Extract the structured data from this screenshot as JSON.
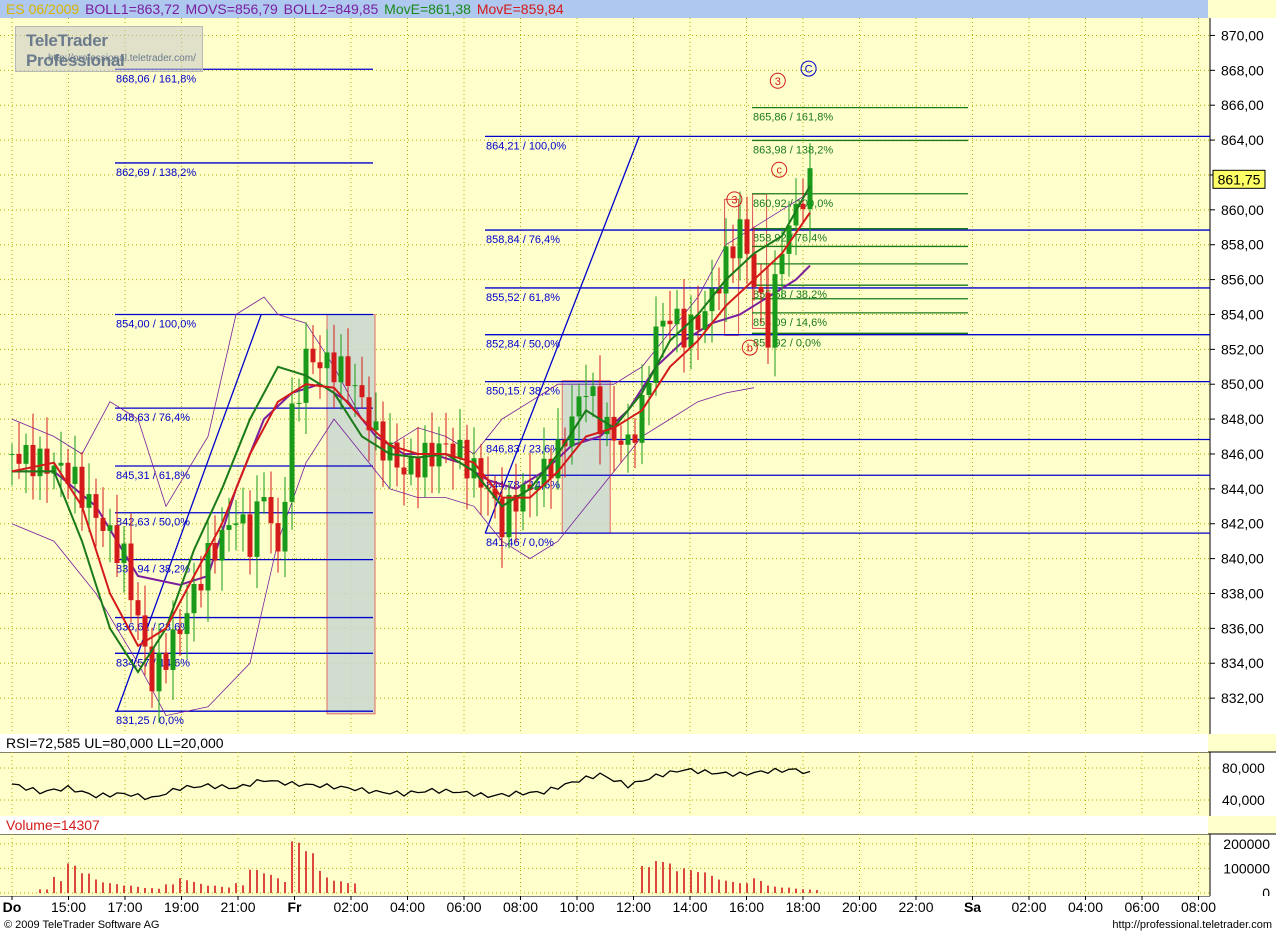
{
  "header": {
    "symbol": "ES 06/2009",
    "indicators": [
      {
        "label": "BOLL1=863,72",
        "color": "#7a1e9e"
      },
      {
        "label": "MOVS=856,79",
        "color": "#7a1e9e"
      },
      {
        "label": "BOLL2=849,85",
        "color": "#7a1e9e"
      },
      {
        "label": "MovE=861,38",
        "color": "#1a8a1a"
      },
      {
        "label": "MovE=859,84",
        "color": "#d41a1a"
      }
    ]
  },
  "logo": {
    "title": "TeleTrader Professional",
    "url": "http://professional.teletrader.com/"
  },
  "current_price": "861,75",
  "rsi_header": "RSI=72,585 UL=80,000 LL=20,000",
  "volume_header": "Volume=14307",
  "footer": {
    "left": "© 2009 TeleTrader Software AG",
    "right": "http://professional.teletrader.com"
  },
  "colors": {
    "background": "#ffffcc",
    "header_bg": "#aec8ef",
    "grid": "#b0b000",
    "fib_blue": "#0000cc",
    "fib_green": "#1a7a1a",
    "bull": "#1a9a1a",
    "bear": "#d41a1a",
    "purple": "#7a1e9e",
    "box_fill": "#c9d8d0",
    "box_edge": "#e05050"
  },
  "chart_data": [
    {
      "type": "candlestick",
      "title": "ES 06/2009",
      "ylim": [
        830,
        871
      ],
      "y_ticks": [
        "832,00",
        "834,00",
        "836,00",
        "838,00",
        "840,00",
        "842,00",
        "844,00",
        "846,00",
        "848,00",
        "850,00",
        "852,00",
        "854,00",
        "856,00",
        "858,00",
        "860,00",
        "862,00",
        "864,00",
        "866,00",
        "868,00",
        "870,00"
      ],
      "x_ticks": [
        "Do",
        "15:00",
        "17:00",
        "19:00",
        "21:00",
        "Fr",
        "02:00",
        "04:00",
        "06:00",
        "08:00",
        "10:00",
        "12:00",
        "14:00",
        "16:00",
        "18:00",
        "20:00",
        "22:00",
        "Sa",
        "02:00",
        "04:00",
        "06:00",
        "08:00"
      ],
      "x_tick_bold": [
        true,
        false,
        false,
        false,
        false,
        true,
        false,
        false,
        false,
        false,
        false,
        false,
        false,
        false,
        false,
        false,
        false,
        true,
        false,
        false,
        false,
        false
      ],
      "grid": true,
      "close_path": [
        [
          0,
          846.0
        ],
        [
          4,
          845.0
        ],
        [
          8,
          840.0
        ],
        [
          10,
          833.0
        ],
        [
          12,
          836.0
        ],
        [
          14,
          840.0
        ],
        [
          16,
          842.5
        ],
        [
          17,
          841.0
        ],
        [
          18,
          844.0
        ],
        [
          19,
          840.0
        ],
        [
          20,
          848.0
        ],
        [
          21,
          851.5
        ],
        [
          23,
          851.0
        ],
        [
          24,
          850.5
        ],
        [
          25,
          849.0
        ],
        [
          26,
          847.0
        ],
        [
          27,
          846.0
        ],
        [
          28,
          845.0
        ],
        [
          29,
          845.5
        ],
        [
          30,
          846.0
        ],
        [
          31,
          846.5
        ],
        [
          32,
          846.0
        ],
        [
          34,
          844.0
        ],
        [
          35,
          842.0
        ],
        [
          36,
          843.5
        ],
        [
          37,
          844.0
        ],
        [
          38,
          845.0
        ],
        [
          39,
          846.0
        ],
        [
          40,
          848.0
        ],
        [
          41,
          850.0
        ],
        [
          42,
          848.0
        ],
        [
          43,
          847.0
        ],
        [
          44,
          846.5
        ],
        [
          45,
          848.5
        ],
        [
          46,
          853.0
        ],
        [
          47,
          854.0
        ],
        [
          48,
          853.0
        ],
        [
          49,
          853.5
        ],
        [
          50,
          855.0
        ],
        [
          51,
          857.0
        ],
        [
          52,
          859.0
        ],
        [
          53,
          856.0
        ],
        [
          54,
          853.0
        ],
        [
          55,
          858.0
        ],
        [
          56,
          860.0
        ],
        [
          57,
          861.5
        ]
      ],
      "bollinger": {
        "upper": [
          [
            0,
            848
          ],
          [
            3,
            847
          ],
          [
            5,
            846
          ],
          [
            7,
            849
          ],
          [
            9,
            848
          ],
          [
            11,
            843
          ],
          [
            14,
            847
          ],
          [
            16,
            854
          ],
          [
            18,
            855
          ],
          [
            19,
            854
          ],
          [
            21,
            853.5
          ],
          [
            23,
            851
          ],
          [
            25,
            848
          ],
          [
            27,
            846.5
          ],
          [
            29,
            847.5
          ],
          [
            31,
            847
          ],
          [
            33,
            846
          ],
          [
            35,
            848
          ],
          [
            37,
            849
          ],
          [
            39,
            850
          ],
          [
            41,
            850
          ],
          [
            43,
            850
          ],
          [
            45,
            851
          ],
          [
            47,
            853
          ],
          [
            49,
            855
          ],
          [
            51,
            858
          ],
          [
            53,
            859
          ],
          [
            55,
            860
          ],
          [
            57,
            861
          ]
        ],
        "middle": [
          [
            0,
            845
          ],
          [
            3,
            845
          ],
          [
            6,
            843
          ],
          [
            9,
            839
          ],
          [
            12,
            838.5
          ],
          [
            14,
            839
          ],
          [
            16,
            844
          ],
          [
            18,
            848
          ],
          [
            20,
            849.5
          ],
          [
            22,
            850
          ],
          [
            24,
            849
          ],
          [
            26,
            847
          ],
          [
            28,
            846
          ],
          [
            30,
            846
          ],
          [
            32,
            845.5
          ],
          [
            34,
            844.5
          ],
          [
            36,
            844
          ],
          [
            38,
            845
          ],
          [
            40,
            846.5
          ],
          [
            42,
            847
          ],
          [
            44,
            848.5
          ],
          [
            46,
            851
          ],
          [
            48,
            852.5
          ],
          [
            50,
            853.5
          ],
          [
            52,
            854
          ],
          [
            54,
            855
          ],
          [
            56,
            856
          ],
          [
            57,
            856.8
          ]
        ],
        "lower": [
          [
            0,
            842
          ],
          [
            3,
            841
          ],
          [
            6,
            838
          ],
          [
            9,
            834
          ],
          [
            11,
            831
          ],
          [
            14,
            831.5
          ],
          [
            17,
            834
          ],
          [
            19,
            841
          ],
          [
            21,
            845.5
          ],
          [
            23,
            848
          ],
          [
            25,
            846
          ],
          [
            27,
            844
          ],
          [
            29,
            843.5
          ],
          [
            31,
            843.5
          ],
          [
            33,
            843
          ],
          [
            35,
            841
          ],
          [
            37,
            840
          ],
          [
            39,
            841
          ],
          [
            41,
            843
          ],
          [
            43,
            845
          ],
          [
            45,
            847
          ],
          [
            47,
            848
          ],
          [
            49,
            849
          ],
          [
            51,
            849.5
          ],
          [
            53,
            849.8
          ]
        ]
      },
      "mov_green": [
        [
          0,
          845
        ],
        [
          3,
          845
        ],
        [
          5,
          841
        ],
        [
          7,
          836
        ],
        [
          9,
          833.5
        ],
        [
          11,
          836
        ],
        [
          13,
          840.5
        ],
        [
          15,
          844
        ],
        [
          17,
          848
        ],
        [
          19,
          851
        ],
        [
          21,
          850.5
        ],
        [
          23,
          849.5
        ],
        [
          25,
          847
        ],
        [
          27,
          846
        ],
        [
          29,
          845.8
        ],
        [
          31,
          846
        ],
        [
          33,
          845
        ],
        [
          35,
          843
        ],
        [
          37,
          844
        ],
        [
          39,
          846
        ],
        [
          41,
          848.5
        ],
        [
          43,
          847.5
        ],
        [
          45,
          849.5
        ],
        [
          47,
          852.5
        ],
        [
          49,
          854
        ],
        [
          51,
          856
        ],
        [
          53,
          857.5
        ],
        [
          55,
          858.5
        ],
        [
          57,
          861.38
        ]
      ],
      "mov_red": [
        [
          0,
          845
        ],
        [
          3,
          845.5
        ],
        [
          5,
          843
        ],
        [
          7,
          838
        ],
        [
          9,
          835
        ],
        [
          11,
          836
        ],
        [
          13,
          839
        ],
        [
          15,
          842
        ],
        [
          17,
          846
        ],
        [
          19,
          849
        ],
        [
          21,
          850
        ],
        [
          23,
          849.8
        ],
        [
          25,
          848
        ],
        [
          27,
          846.5
        ],
        [
          29,
          846
        ],
        [
          31,
          846
        ],
        [
          33,
          845.5
        ],
        [
          35,
          843.5
        ],
        [
          37,
          843.5
        ],
        [
          39,
          845
        ],
        [
          41,
          847
        ],
        [
          43,
          847.5
        ],
        [
          45,
          848.5
        ],
        [
          47,
          851
        ],
        [
          49,
          852.5
        ],
        [
          51,
          854.5
        ],
        [
          53,
          856
        ],
        [
          55,
          857.5
        ],
        [
          57,
          859.84
        ]
      ],
      "fib_sets": [
        {
          "name": "fib-set-1",
          "levels": [
            {
              "price": 868.06,
              "label": "868,06 / 161,8%"
            },
            {
              "price": 862.69,
              "label": "862,69 / 138,2%"
            },
            {
              "price": 854.0,
              "label": "854,00 / 100,0%"
            },
            {
              "price": 848.63,
              "label": "848,63 / 76,4%"
            },
            {
              "price": 845.31,
              "label": "845,31 / 61,8%"
            },
            {
              "price": 842.63,
              "label": "842,63 / 50,0%"
            },
            {
              "price": 839.94,
              "label": "839,94 / 38,2%"
            },
            {
              "price": 836.62,
              "label": "836,62 / 23,6%"
            },
            {
              "price": 834.57,
              "label": "834,57 / 14,6%"
            },
            {
              "price": 831.25,
              "label": "831,25 / 0,0%"
            }
          ]
        },
        {
          "name": "fib-set-2",
          "levels": [
            {
              "price": 864.21,
              "label": "864,21 / 100,0%"
            },
            {
              "price": 858.84,
              "label": "858,84 / 76,4%"
            },
            {
              "price": 855.52,
              "label": "855,52 / 61,8%"
            },
            {
              "price": 852.84,
              "label": "852,84 / 50,0%"
            },
            {
              "price": 850.15,
              "label": "850,15 / 38,2%"
            },
            {
              "price": 846.83,
              "label": "846,83 / 23,6%"
            },
            {
              "price": 844.78,
              "label": "844,78 / 14,6%"
            },
            {
              "price": 841.46,
              "label": "841,46 / 0,0%"
            }
          ]
        },
        {
          "name": "fib-set-3",
          "levels": [
            {
              "price": 865.86,
              "label": "865,86 / 161,8%"
            },
            {
              "price": 863.98,
              "label": "863,98 / 138,2%"
            },
            {
              "price": 860.92,
              "label": "860,92 / 100,0%"
            },
            {
              "price": 858.92,
              "label": "858,92 / 76,4%"
            },
            {
              "price": 857.9,
              "label": ""
            },
            {
              "price": 856.9,
              "label": ""
            },
            {
              "price": 855.68,
              "label": "855,68 / 38,2%"
            },
            {
              "price": 854.9,
              "label": ""
            },
            {
              "price": 854.09,
              "label": "854,09 / 14,6%"
            },
            {
              "price": 852.92,
              "label": "852,92 / 0,0%"
            }
          ]
        }
      ],
      "wave_labels": [
        "3",
        "C",
        "3",
        "c",
        "b"
      ],
      "current_price": 861.75
    },
    {
      "type": "line",
      "title": "RSI=72,585 UL=80,000 LL=20,000",
      "ylim": [
        20,
        100
      ],
      "y_ticks": [
        "80,000",
        "40,000"
      ],
      "values": [
        [
          0,
          60
        ],
        [
          2,
          50
        ],
        [
          4,
          55
        ],
        [
          6,
          45
        ],
        [
          8,
          48
        ],
        [
          10,
          42
        ],
        [
          12,
          55
        ],
        [
          14,
          58
        ],
        [
          16,
          55
        ],
        [
          18,
          65
        ],
        [
          20,
          60
        ],
        [
          22,
          58
        ],
        [
          24,
          55
        ],
        [
          26,
          50
        ],
        [
          28,
          48
        ],
        [
          30,
          52
        ],
        [
          32,
          50
        ],
        [
          34,
          45
        ],
        [
          36,
          48
        ],
        [
          38,
          50
        ],
        [
          40,
          62
        ],
        [
          42,
          72
        ],
        [
          44,
          58
        ],
        [
          46,
          70
        ],
        [
          48,
          78
        ],
        [
          50,
          74
        ],
        [
          52,
          72
        ],
        [
          54,
          76
        ],
        [
          56,
          78
        ],
        [
          57,
          72.585
        ]
      ]
    },
    {
      "type": "bar",
      "title": "Volume=14307",
      "ylim": [
        0,
        240000
      ],
      "y_ticks": [
        "200000",
        "100000",
        "0"
      ],
      "values": [
        [
          2,
          15000
        ],
        [
          3,
          65000
        ],
        [
          4,
          120000
        ],
        [
          5,
          80000
        ],
        [
          6,
          55000
        ],
        [
          7,
          40000
        ],
        [
          8,
          30000
        ],
        [
          9,
          25000
        ],
        [
          10,
          20000
        ],
        [
          11,
          35000
        ],
        [
          12,
          60000
        ],
        [
          13,
          45000
        ],
        [
          14,
          30000
        ],
        [
          15,
          25000
        ],
        [
          16,
          40000
        ],
        [
          17,
          95000
        ],
        [
          18,
          80000
        ],
        [
          19,
          60000
        ],
        [
          20,
          210000
        ],
        [
          21,
          170000
        ],
        [
          22,
          90000
        ],
        [
          23,
          50000
        ],
        [
          24,
          40000
        ],
        [
          45,
          110000
        ],
        [
          46,
          130000
        ],
        [
          47,
          120000
        ],
        [
          48,
          100000
        ],
        [
          49,
          85000
        ],
        [
          50,
          70000
        ],
        [
          51,
          50000
        ],
        [
          52,
          40000
        ],
        [
          53,
          60000
        ],
        [
          54,
          30000
        ],
        [
          55,
          22000
        ],
        [
          56,
          18000
        ],
        [
          57,
          14307
        ]
      ]
    }
  ]
}
